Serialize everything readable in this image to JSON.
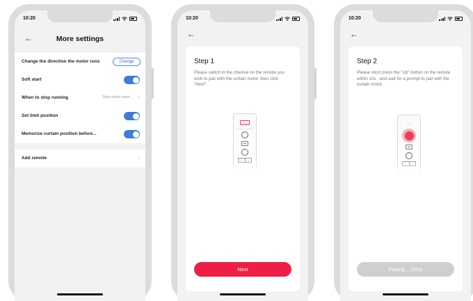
{
  "status_bar": {
    "time": "10:20"
  },
  "screen1": {
    "title": "More settings",
    "rows": {
      "direction": {
        "label": "Change the direction the motor runs",
        "button": "Change"
      },
      "soft_start": {
        "label": "Soft start",
        "toggle_on": true
      },
      "stop": {
        "label": "When to stop running",
        "value": "Stop while meet..."
      },
      "limit": {
        "label": "Set limit position",
        "toggle_on": true
      },
      "memorize": {
        "label": "Memorize curtain position before...",
        "toggle_on": true
      },
      "add_remote": {
        "label": "Add remote"
      }
    }
  },
  "screen2": {
    "title": "Step 1",
    "instructions": "Please switch to the channel on the remote you wish to pair with the curtain motor, then click \"Next\".",
    "remote_channel": "1-1",
    "button": "Next"
  },
  "screen3": {
    "title": "Step 2",
    "instructions": "Please short press the \"Up\" button on the remote within 10s , and wait for a prompt to pair with the curtain motor.",
    "remote_channel": "1-1",
    "button": "Pairing... (10s)"
  },
  "colors": {
    "accent_blue": "#3b7cdd",
    "accent_red": "#ee1e45",
    "disabled_gray": "#cfcfcf"
  },
  "icons": [
    "back-arrow-icon",
    "signal-icon",
    "wifi-icon",
    "battery-icon",
    "chevron-right-icon",
    "up-arrow-icon",
    "down-arrow-icon",
    "stop-icon"
  ]
}
